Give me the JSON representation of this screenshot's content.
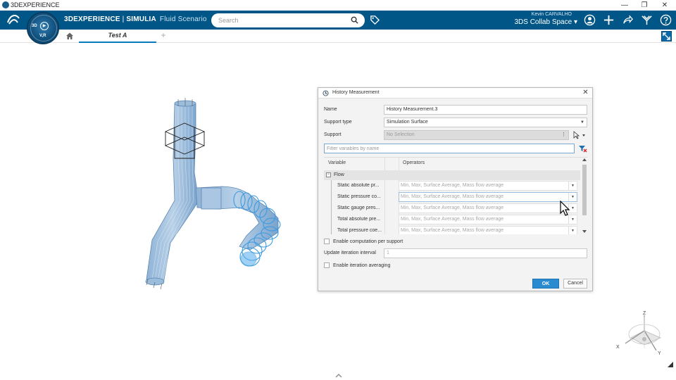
{
  "window": {
    "title": "3DEXPERIENCE",
    "minimize": "—",
    "restore": "❐",
    "close": "✕"
  },
  "topbar": {
    "brand_primary": "3DEXPERIENCE",
    "brand_separator": " | ",
    "brand_secondary": "SIMULIA",
    "brand_app": "Fluid Scenario",
    "search_placeholder": "Search",
    "user_name": "Kevin CARVALHO",
    "collab_space": "3DS Collab Space",
    "compass_3d": "3D",
    "compass_vr": "V,R",
    "accent_color": "#005686"
  },
  "tabs": {
    "active_label": "Test A",
    "add_label": "+"
  },
  "dialog": {
    "title": "History Measurement",
    "close_label": "✕",
    "name_label": "Name",
    "name_value": "History Measurement.3",
    "support_type_label": "Support type",
    "support_type_value": "Simulation Surface",
    "support_label": "Support",
    "support_value": "No Selection",
    "filter_placeholder": "Filter variables by name",
    "col_variable": "Variable",
    "col_operators": "Operators",
    "group_name": "Flow",
    "rows": [
      {
        "name": "Static absolute pr...",
        "operators": "Min, Max, Surface Average, Mass flow average"
      },
      {
        "name": "Static pressure co...",
        "operators": "Min, Max, Surface Average, Mass flow average"
      },
      {
        "name": "Static gauge pres...",
        "operators": "Min, Max, Surface Average, Mass flow average"
      },
      {
        "name": "Total absolute pre...",
        "operators": "Min, Max, Surface Average, Mass flow average"
      },
      {
        "name": "Total pressure coe...",
        "operators": "Min, Max, Surface Average, Mass flow average"
      }
    ],
    "enable_per_support_label": "Enable computation per support",
    "update_interval_label": "Update iteration interval",
    "update_interval_value": "1",
    "enable_averaging_label": "Enable iteration averaging",
    "ok_label": "OK",
    "cancel_label": "Cancel"
  },
  "triad": {
    "x": "X",
    "y": "Y",
    "z": "Z"
  }
}
